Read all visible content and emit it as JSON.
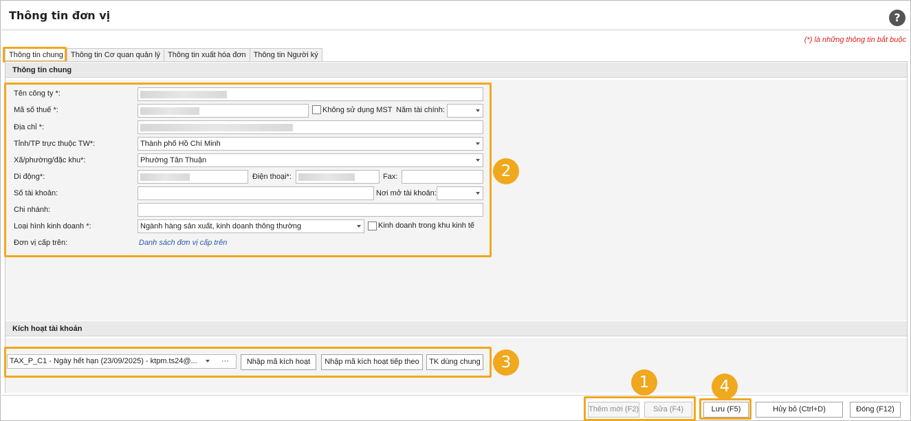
{
  "window": {
    "title": "Thông tin đơn vị",
    "help_symbol": "?",
    "required_note": "(*)  là những thông tin bắt buộc"
  },
  "tabs": [
    {
      "label": "Thông tin chung",
      "active": true
    },
    {
      "label": "Thông tin Cơ quan quản lý",
      "active": false
    },
    {
      "label": "Thông tin xuất hóa đơn",
      "active": false
    },
    {
      "label": "Thông tin Người ký",
      "active": false
    }
  ],
  "general": {
    "section_title": "Thông tin chung",
    "company_name_label": "Tên công ty *:",
    "tax_code_label": "Mã số thuế *:",
    "no_tax_code_label": "Không sử dụng MST",
    "fiscal_year_label": "Năm tài chính:",
    "address_label": "Địa chỉ *:",
    "province_label": "Tỉnh/TP trực thuộc TW*:",
    "province_value": "Thành phố Hồ Chí Minh",
    "ward_label": "Xã/phường/đặc khu*:",
    "ward_value": "Phường Tân Thuận",
    "mobile_label": "Di động*:",
    "phone_label": "Điện thoại*:",
    "fax_label": "Fax:",
    "account_no_label": "Số tài khoản:",
    "bank_label": "Nơi mở tài khoản:",
    "branch_label": "Chi nhánh:",
    "business_type_label": "Loại hình kinh doanh *:",
    "business_type_value": "Ngành hàng sản xuất, kinh doanh thông thường",
    "economic_zone_label": "Kinh doanh trong khu kinh tế",
    "parent_unit_label": "Đơn vị cấp trên:",
    "parent_unit_link": "Danh sách đơn vị cấp trên"
  },
  "activation": {
    "section_title": "Kích hoạt tài khoản",
    "license_value": "TAX_P_C1 - Ngày hết hạn (23/09/2025) - ktpm.ts24@...",
    "ellipsis": "···",
    "enter_code_button": "Nhập mã kích hoạt",
    "enter_next_code_button": "Nhập mã kích hoạt tiếp theo",
    "shared_account_button": "TK dùng chung"
  },
  "footer": {
    "add_button": "Thêm mới (F2)",
    "edit_button": "Sửa (F4)",
    "save_button": "Lưu (F5)",
    "cancel_button": "Hủy bỏ (Ctrl+D)",
    "close_button": "Đóng (F12)"
  },
  "callouts": [
    "1",
    "2",
    "3",
    "4"
  ],
  "colors": {
    "highlight": "#f0a81e",
    "required_note": "#e0201b",
    "link": "#2a5aa6"
  }
}
